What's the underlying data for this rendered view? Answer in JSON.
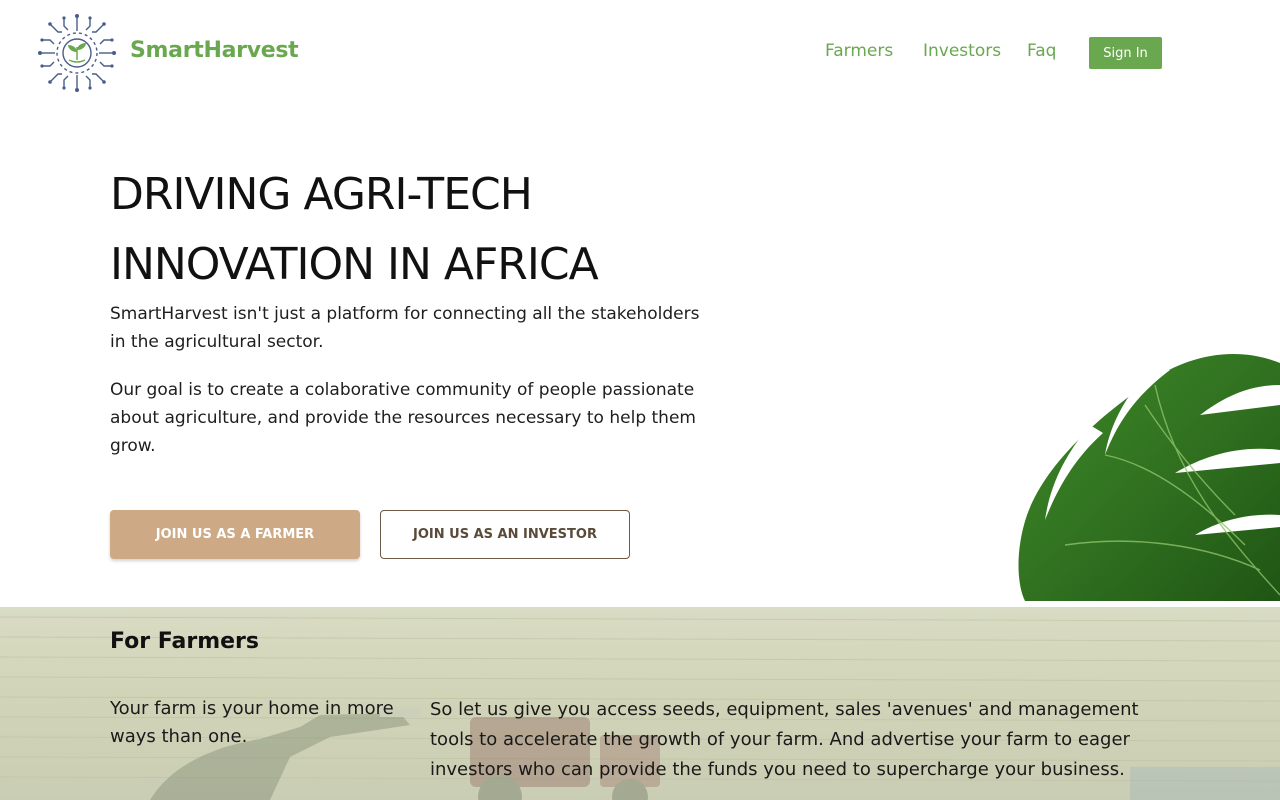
{
  "brand": {
    "name": "SmartHarvest",
    "logo_icon": "circuit-sun-sprout-icon",
    "text_color": "#6aa84f"
  },
  "nav": {
    "links": [
      {
        "label": "Farmers"
      },
      {
        "label": "Investors"
      },
      {
        "label": "Faq"
      }
    ],
    "link_color": "#6aa84f",
    "signin_label": "Sign In",
    "signin_color": "#6aa84f"
  },
  "hero": {
    "title_lines": [
      "DRIVING AGRI-TECH",
      "INNOVATION IN AFRICA"
    ],
    "paragraphs": [
      "SmartHarvest isn't just a platform for connecting all the stakeholders in the agricultural sector.",
      "Our goal is to create a colaborative community of people passionate about agriculture, and provide the resources necessary to help them grow."
    ],
    "cta_farmer": "JOIN US AS A FARMER",
    "cta_investor": "JOIN US AS AN INVESTOR",
    "cta_farmer_color": "#cda985",
    "decor_icon": "monstera-leaf-icon"
  },
  "farmers_section": {
    "title": "For Farmers",
    "left_text": "Your farm is your home in more ways than one.",
    "right_text": "So let us give you access seeds, equipment, sales 'avenues' and management tools to accelerate the growth of your farm. And advertise your farm to eager investors who can provide the funds you need to supercharge your business."
  }
}
